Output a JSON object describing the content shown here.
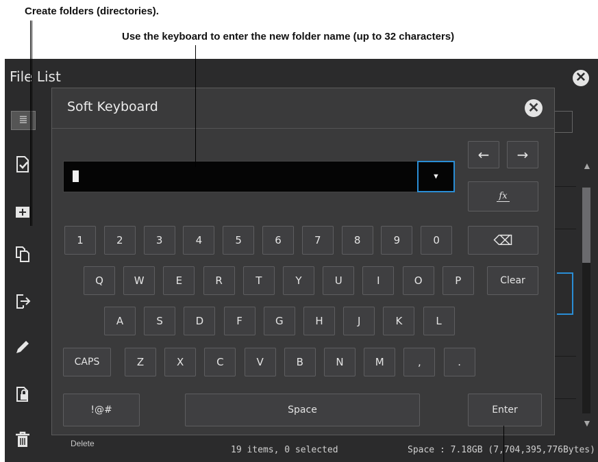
{
  "annotations": {
    "create_folders": "Create folders (directories).",
    "use_keyboard": "Use the keyboard to enter the new folder name (up to 32 characters)"
  },
  "file_list": {
    "title": "File List",
    "close_glyph": "✕",
    "delete_label": "Delete",
    "status_items": "19 items, 0 selected",
    "status_space": "Space : 7.18GB (7,704,395,776Bytes)"
  },
  "sidebar_icons": [
    "list-icon",
    "check-file-icon",
    "new-folder-icon",
    "copy-icon",
    "move-icon",
    "rename-pencil-icon",
    "protect-lock-icon",
    "trash-icon"
  ],
  "keyboard": {
    "title": "Soft Keyboard",
    "close_glyph": "✕",
    "input_value": "",
    "dropdown_glyph": "▼",
    "arrow_left": "←",
    "arrow_right": "→",
    "fx_label": "fx",
    "backspace_glyph": "⌫",
    "row1": [
      "1",
      "2",
      "3",
      "4",
      "5",
      "6",
      "7",
      "8",
      "9",
      "0"
    ],
    "row2": [
      "Q",
      "W",
      "E",
      "R",
      "T",
      "Y",
      "U",
      "I",
      "O",
      "P"
    ],
    "clear": "Clear",
    "row3": [
      "A",
      "S",
      "D",
      "F",
      "G",
      "H",
      "J",
      "K",
      "L"
    ],
    "caps": "CAPS",
    "row4": [
      "Z",
      "X",
      "C",
      "V",
      "B",
      "N",
      "M",
      ",",
      "."
    ],
    "symbols": "!@#",
    "space": "Space",
    "enter": "Enter"
  },
  "colors": {
    "accent": "#2a8ed6",
    "screen_bg": "#2b2b2c",
    "dialog_bg": "#3a3a3b"
  }
}
